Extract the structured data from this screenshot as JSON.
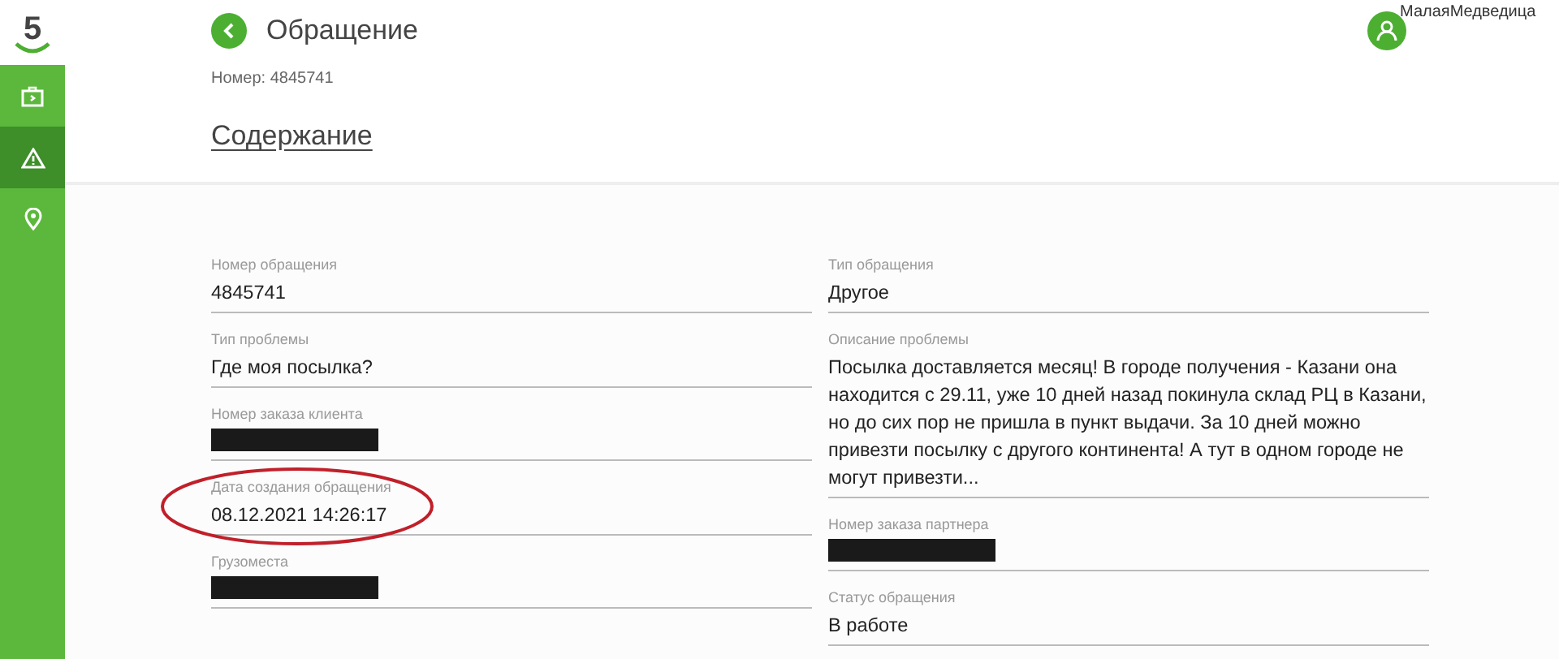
{
  "sidebar": {
    "logo": "5",
    "items": [
      {
        "kind": "box",
        "selected": false
      },
      {
        "kind": "warning",
        "selected": true
      },
      {
        "kind": "pin",
        "selected": false
      }
    ]
  },
  "header": {
    "title": "Обращение",
    "user": "МалаяМедведица",
    "number": "Номер: 4845741"
  },
  "section_title": "Содержание",
  "columns": [
    [
      {
        "label": "Номер обращения",
        "kind": "text",
        "value": "4845741",
        "highlighted": false
      },
      {
        "label": "Тип проблемы",
        "kind": "text",
        "value": "Где моя посылка?",
        "highlighted": false
      },
      {
        "label": "Номер заказа клиента",
        "kind": "redacted",
        "highlighted": false
      },
      {
        "label": "Дата создания обращения",
        "kind": "text",
        "value": "08.12.2021 14:26:17",
        "highlighted": true
      },
      {
        "label": "Грузоместа",
        "kind": "redacted",
        "highlighted": false
      }
    ],
    [
      {
        "label": "Тип обращения",
        "kind": "text",
        "value": "Другое",
        "highlighted": false
      },
      {
        "label": "Описание проблемы",
        "kind": "text",
        "value": "Посылка доставляется месяц! В городе получения - Казани она находится с 29.11, уже 10 дней назад покинула склад РЦ в Казани, но до сих пор не пришла в пункт выдачи. За 10 дней можно привезти посылку с другого континента! А тут в одном городе не могут привезти...",
        "highlighted": false
      },
      {
        "label": "Номер заказа партнера",
        "kind": "redacted",
        "highlighted": false
      },
      {
        "label": "Статус обращения",
        "kind": "text",
        "value": "В работе",
        "highlighted": false
      }
    ]
  ]
}
